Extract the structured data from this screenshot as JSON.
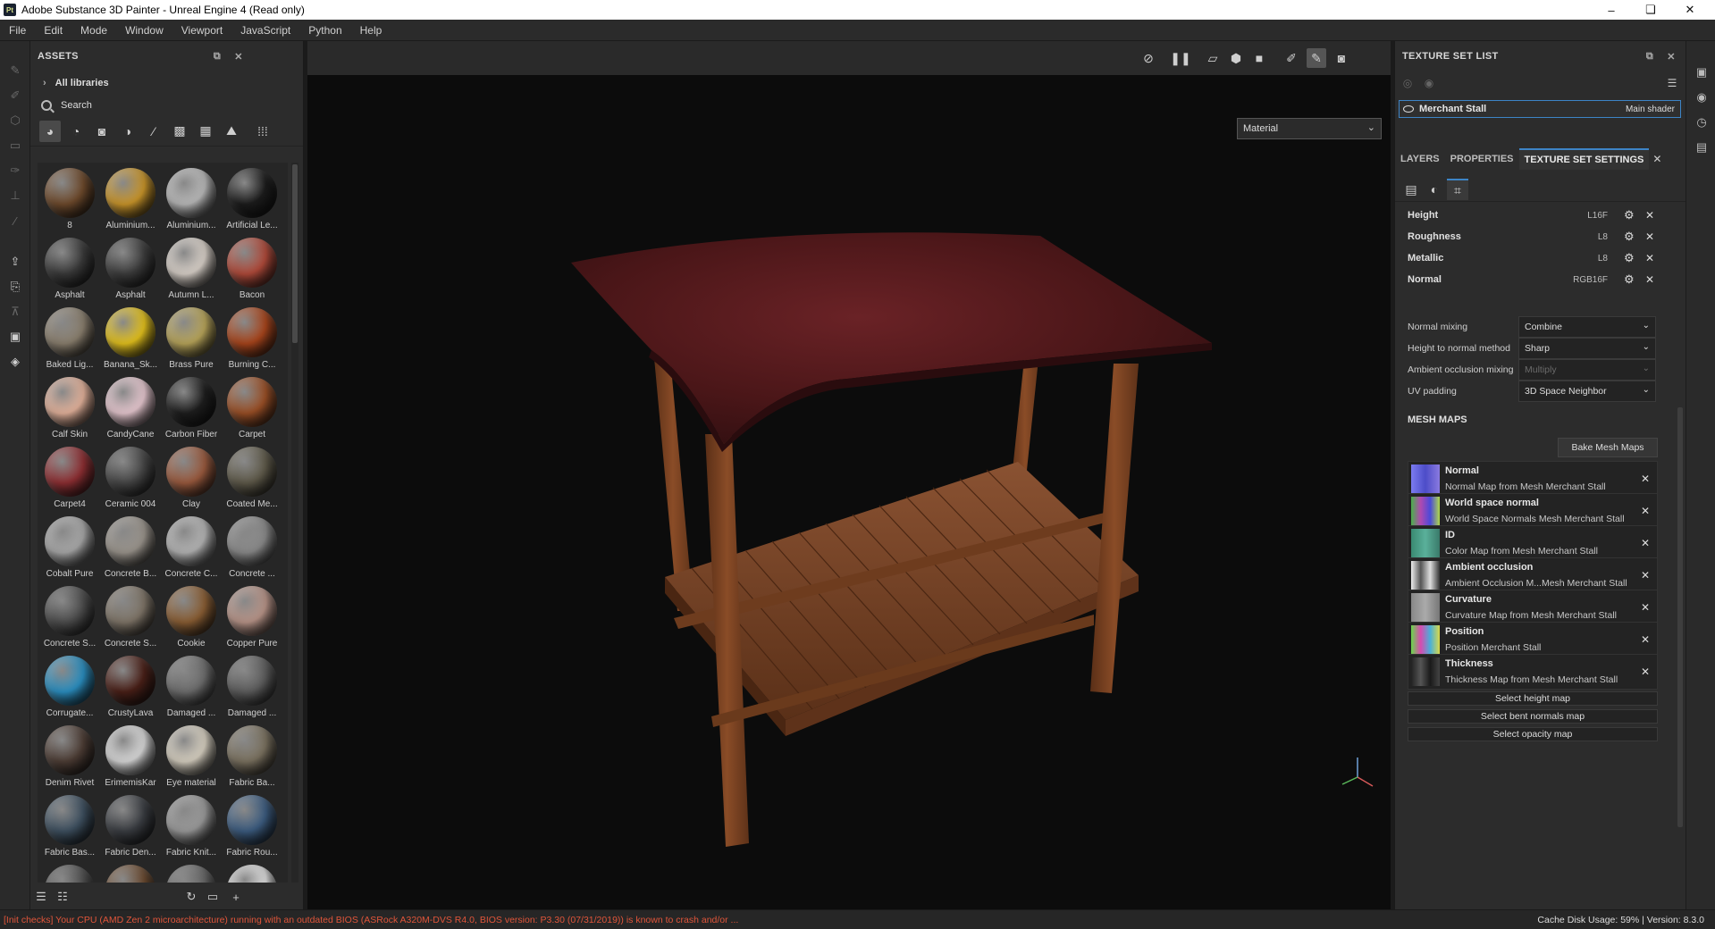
{
  "window": {
    "title": "Adobe Substance 3D Painter - Unreal Engine 4 (Read only)",
    "app_icon": "Pt",
    "minimize_label": "–",
    "maximize_label": "❏",
    "close_label": "✕"
  },
  "menu": [
    "File",
    "Edit",
    "Mode",
    "Window",
    "Viewport",
    "JavaScript",
    "Python",
    "Help"
  ],
  "assets": {
    "title": "ASSETS",
    "libraries_label": "All libraries",
    "search_placeholder": "Search",
    "items": [
      {
        "label": "8",
        "color": "#6e4a2c"
      },
      {
        "label": "Aluminium...",
        "color": "#c9952a"
      },
      {
        "label": "Aluminium...",
        "color": "#b9b9b9"
      },
      {
        "label": "Artificial Le...",
        "color": "#1c1c1c"
      },
      {
        "label": "Asphalt",
        "color": "#3a3a3a"
      },
      {
        "label": "Asphalt",
        "color": "#3d3d3d"
      },
      {
        "label": "Autumn L...",
        "color": "#d8d0c8"
      },
      {
        "label": "Bacon",
        "color": "#b04a3a"
      },
      {
        "label": "Baked Lig...",
        "color": "#8a7f6e"
      },
      {
        "label": "Banana_Sk...",
        "color": "#e3c11d"
      },
      {
        "label": "Brass Pure",
        "color": "#b8a55a"
      },
      {
        "label": "Burning C...",
        "color": "#a8451c"
      },
      {
        "label": "Calf Skin",
        "color": "#e3b29b"
      },
      {
        "label": "CandyCane",
        "color": "#e6c7cf"
      },
      {
        "label": "Carbon Fiber",
        "color": "#1e1e1e"
      },
      {
        "label": "Carpet",
        "color": "#9a4f26"
      },
      {
        "label": "Carpet4",
        "color": "#8e2f33"
      },
      {
        "label": "Ceramic 004",
        "color": "#474747"
      },
      {
        "label": "Clay",
        "color": "#9a5a3e"
      },
      {
        "label": "Coated Me...",
        "color": "#5f5a4a"
      },
      {
        "label": "Cobalt Pure",
        "color": "#a8a8a8"
      },
      {
        "label": "Concrete B...",
        "color": "#9a948c"
      },
      {
        "label": "Concrete C...",
        "color": "#b4b4b4"
      },
      {
        "label": "Concrete ...",
        "color": "#8a8a8a"
      },
      {
        "label": "Concrete S...",
        "color": "#4e4e4e"
      },
      {
        "label": "Concrete S...",
        "color": "#7f7568"
      },
      {
        "label": "Cookie",
        "color": "#8a5e34"
      },
      {
        "label": "Copper Pure",
        "color": "#b89488"
      },
      {
        "label": "Corrugate...",
        "color": "#2b8fc1"
      },
      {
        "label": "CrustyLava",
        "color": "#4a2018"
      },
      {
        "label": "Damaged ...",
        "color": "#6e6e6e"
      },
      {
        "label": "Damaged ...",
        "color": "#5e5e5e"
      },
      {
        "label": "Denim Rivet",
        "color": "#4d3d35"
      },
      {
        "label": "ErimemisKar",
        "color": "#d8d8d8"
      },
      {
        "label": "Eye material",
        "color": "#d6cfc0"
      },
      {
        "label": "Fabric Ba...",
        "color": "#7b7260"
      },
      {
        "label": "Fabric Bas...",
        "color": "#3e5060"
      },
      {
        "label": "Fabric Den...",
        "color": "#3a3d42"
      },
      {
        "label": "Fabric Knit...",
        "color": "#9a9a9a"
      },
      {
        "label": "Fabric Rou...",
        "color": "#3c5c80"
      },
      {
        "label": "",
        "color": "#505050"
      },
      {
        "label": "",
        "color": "#6a4a30"
      },
      {
        "label": "",
        "color": "#666666"
      },
      {
        "label": "",
        "color": "#dddddd"
      }
    ]
  },
  "viewport": {
    "material_mode": "Material"
  },
  "texture_set_list": {
    "title": "TEXTURE SET LIST",
    "set_name": "Merchant Stall",
    "shader": "Main shader"
  },
  "tabs": {
    "layers": "LAYERS",
    "properties": "PROPERTIES",
    "settings": "TEXTURE SET SETTINGS"
  },
  "channels": [
    {
      "name": "Height",
      "format": "L16F"
    },
    {
      "name": "Roughness",
      "format": "L8"
    },
    {
      "name": "Metallic",
      "format": "L8"
    },
    {
      "name": "Normal",
      "format": "RGB16F"
    }
  ],
  "settings": [
    {
      "label": "Normal mixing",
      "value": "Combine",
      "enabled": true
    },
    {
      "label": "Height to normal method",
      "value": "Sharp",
      "enabled": true
    },
    {
      "label": "Ambient occlusion mixing",
      "value": "Multiply",
      "enabled": false
    },
    {
      "label": "UV padding",
      "value": "3D Space Neighbor",
      "enabled": true
    }
  ],
  "mesh_maps": {
    "title": "MESH MAPS",
    "bake_label": "Bake Mesh Maps",
    "items": [
      {
        "name": "Normal",
        "source": "Normal Map from Mesh Merchant Stall",
        "thumb": "#6a6ad8"
      },
      {
        "name": "World space normal",
        "source": "World Space Normals Mesh Merchant Stall",
        "thumb": "#5fa05f"
      },
      {
        "name": "ID",
        "source": "Color Map from Mesh Merchant Stall",
        "thumb": "#4a8a7a"
      },
      {
        "name": "Ambient occlusion",
        "source": "Ambient Occlusion M...Mesh Merchant Stall",
        "thumb": "#bdbdbd"
      },
      {
        "name": "Curvature",
        "source": "Curvature Map from Mesh Merchant Stall",
        "thumb": "#8a8a8a"
      },
      {
        "name": "Position",
        "source": "Position Merchant Stall",
        "thumb": "#7ab04a"
      },
      {
        "name": "Thickness",
        "source": "Thickness Map from Mesh Merchant Stall",
        "thumb": "#3a3a3a"
      }
    ],
    "select_buttons": [
      "Select height map",
      "Select bent normals map",
      "Select opacity map"
    ]
  },
  "status": {
    "warning": "[Init checks] Your CPU (AMD Zen 2 microarchitecture) running with an outdated BIOS (ASRock A320M-DVS R4.0, BIOS version: P3.30 (07/31/2019)) is known to crash and/or ...",
    "cache": "Cache Disk Usage:   59% | Version: 8.3.0"
  },
  "colors": {
    "accent": "#3d84c6",
    "warning": "#e0553a",
    "cloth": "#5a1e20",
    "wood": "#7a4423"
  }
}
